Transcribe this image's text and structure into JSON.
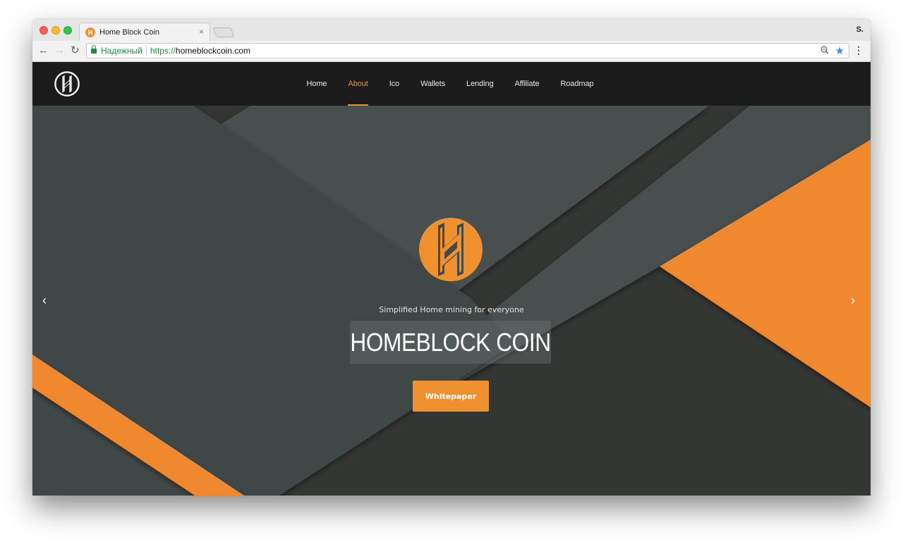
{
  "browser": {
    "tab_title": "Home Block Coin",
    "tab_close": "×",
    "profile_initial": "S.",
    "security_label": "Надежный",
    "url_scheme": "https://",
    "url_host": "homeblockcoin.com",
    "icons": {
      "back": "←",
      "forward": "→",
      "reload": "↻",
      "zoom": "⚲",
      "bookmark": "★",
      "menu": "⋮"
    }
  },
  "site": {
    "nav": [
      {
        "label": "Home",
        "active": false
      },
      {
        "label": "About",
        "active": true
      },
      {
        "label": "Ico",
        "active": false
      },
      {
        "label": "Wallets",
        "active": false
      },
      {
        "label": "Lending",
        "active": false
      },
      {
        "label": "Affiliate",
        "active": false
      },
      {
        "label": "Roadmap",
        "active": false
      }
    ],
    "hero": {
      "tagline": "Simplified Home mining for everyone",
      "title": "HOMEBLOCK COIN",
      "cta_label": "Whitepaper",
      "prev_arrow": "‹",
      "next_arrow": "›"
    },
    "colors": {
      "accent": "#f0912f",
      "nav_bg": "#1c1c1c",
      "hero_dark": "#343634",
      "hero_mid": "#414647",
      "hero_light": "#4a5050"
    }
  }
}
